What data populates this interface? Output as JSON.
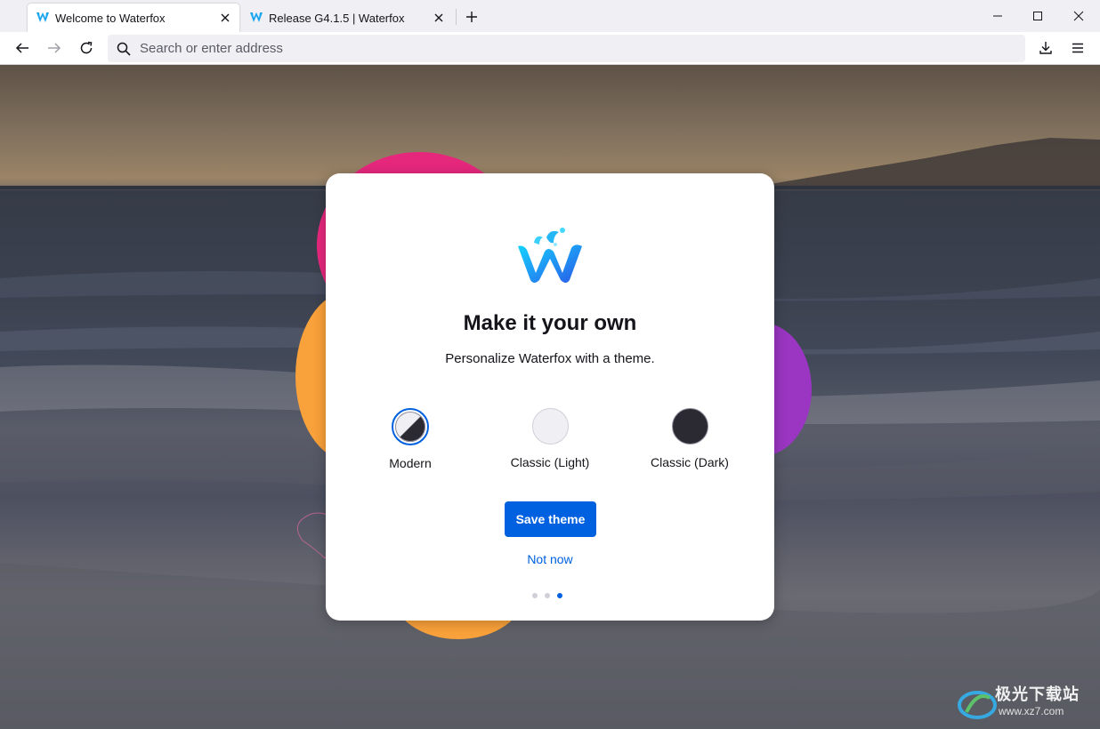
{
  "browser": {
    "tabs": [
      {
        "title": "Welcome to Waterfox",
        "active": true
      },
      {
        "title": "Release G4.1.5 | Waterfox",
        "active": false
      }
    ],
    "address_placeholder": "Search or enter address"
  },
  "icons": {
    "back": "arrow-left-icon",
    "forward": "arrow-right-icon",
    "reload": "reload-icon",
    "search": "search-icon",
    "downloads": "download-icon",
    "menu": "hamburger-menu-icon",
    "new_tab": "plus-icon",
    "tab_close": "close-icon",
    "minimize": "minimize-icon",
    "maximize": "maximize-icon",
    "window_close": "close-icon",
    "brand": "waterfox-logo"
  },
  "onboarding": {
    "title": "Make it your own",
    "subtitle": "Personalize Waterfox with a theme.",
    "themes": [
      {
        "label": "Modern",
        "selected": true
      },
      {
        "label": "Classic (Light)",
        "selected": false
      },
      {
        "label": "Classic (Dark)",
        "selected": false
      }
    ],
    "primary_button": "Save theme",
    "secondary_link": "Not now",
    "steps_total": 3,
    "current_step": 3
  },
  "watermark": {
    "text": "极光下载站",
    "url": "www.xz7.com"
  },
  "colors": {
    "accent": "#0061e0",
    "blob_pink": "#e6287d",
    "blob_orange": "#f9a13a",
    "blob_purple": "#9a36c2",
    "dark_swatch": "#2b2a33",
    "light_swatch": "#f0f0f4"
  }
}
